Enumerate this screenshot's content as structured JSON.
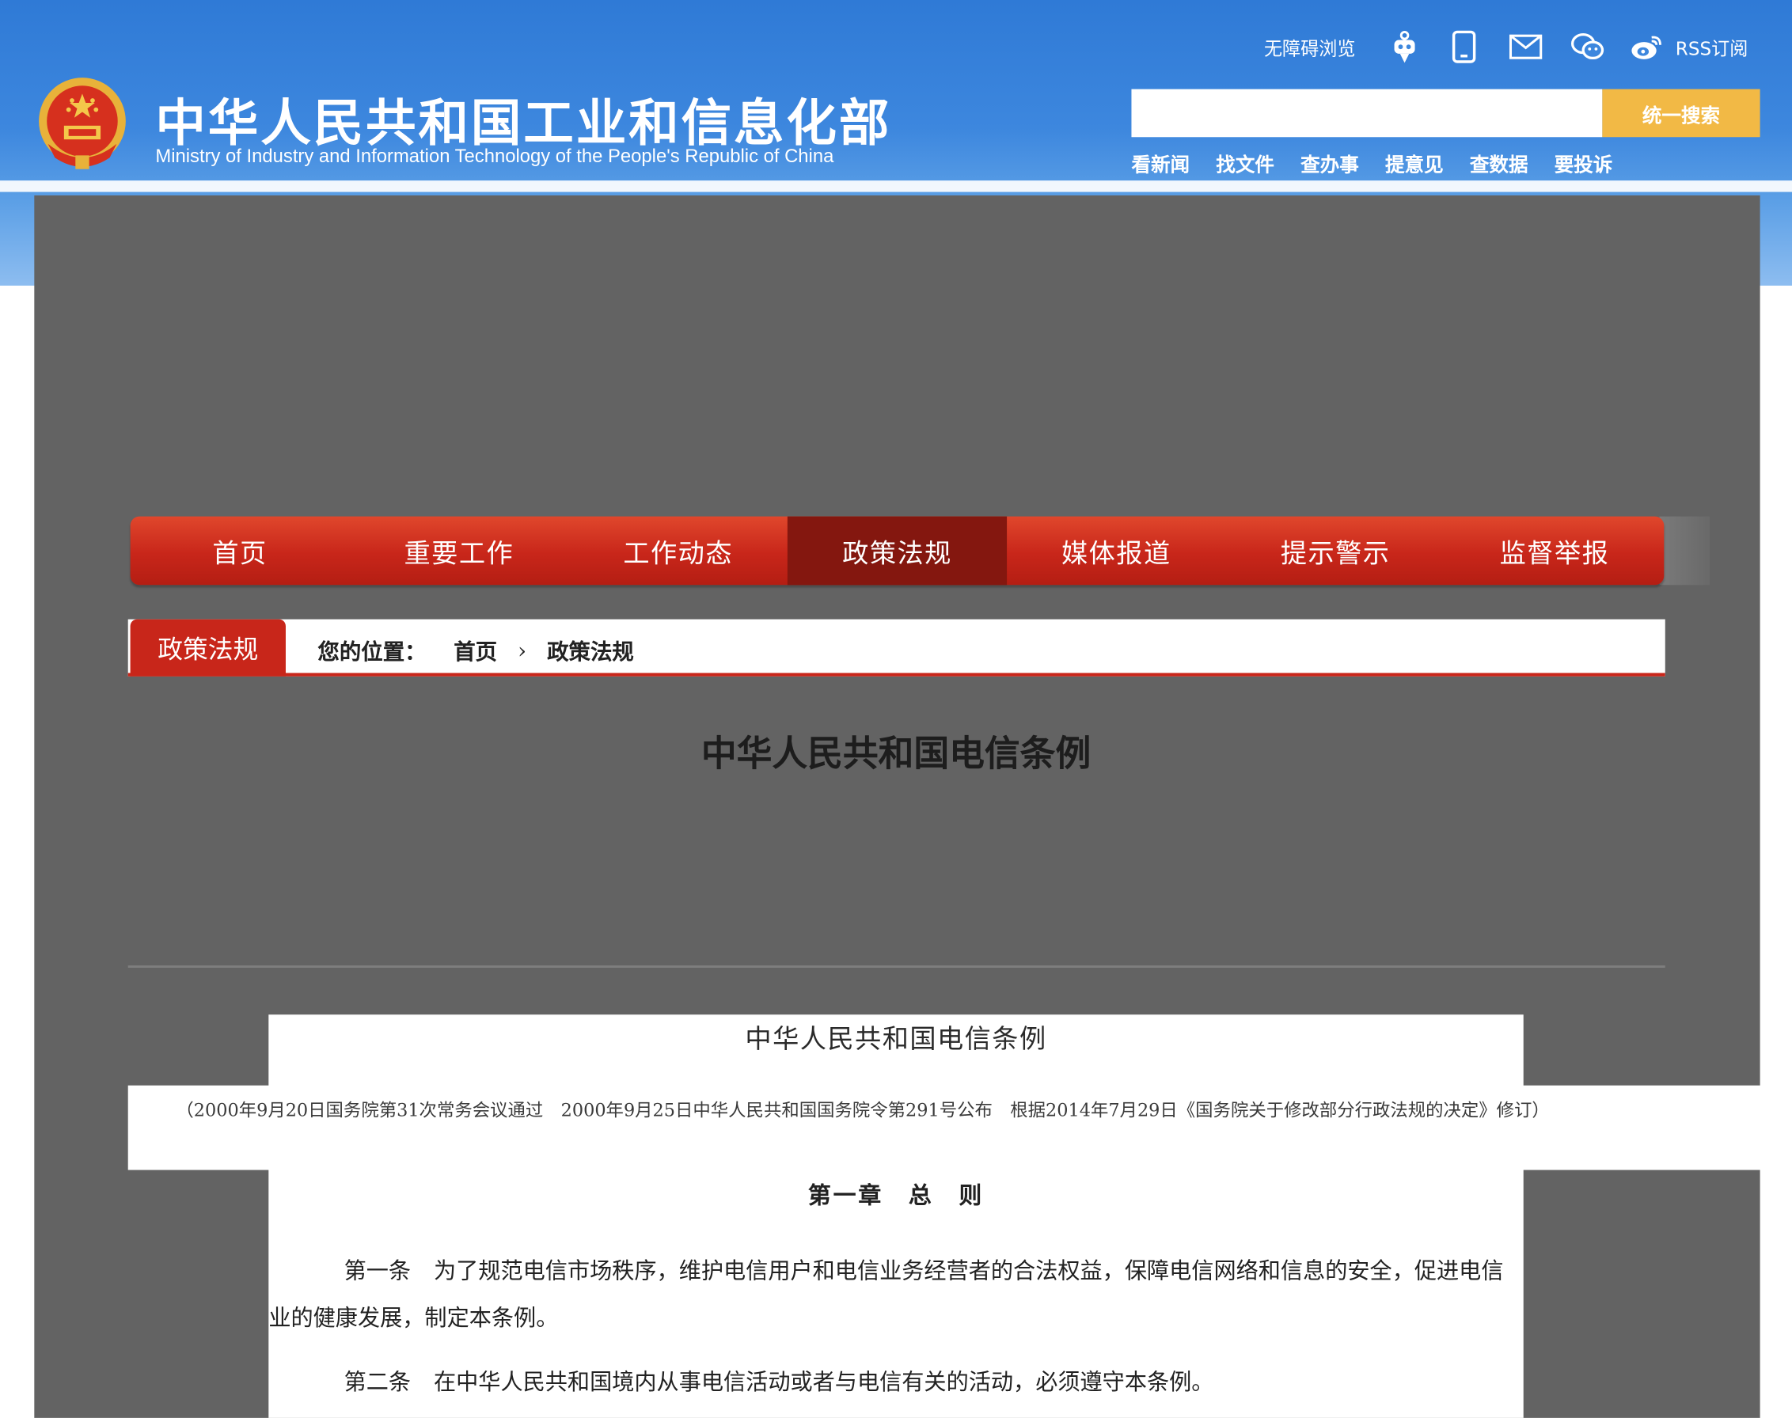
{
  "header": {
    "title": "中华人民共和国工业和信息化部",
    "subtitle": "Ministry of Industry and Information Technology of the People's Republic of China",
    "accessibility_label": "无障碍浏览",
    "rss_label": "RSS订阅",
    "icons": [
      "robot-icon",
      "mobile-icon",
      "mail-icon",
      "wechat-icon",
      "weibo-icon"
    ],
    "search_placeholder": "",
    "search_button": "统一搜索",
    "quick_links": [
      "看新闻",
      "找文件",
      "查办事",
      "提意见",
      "查数据",
      "要投诉"
    ]
  },
  "nav": {
    "items": [
      "首页",
      "重要工作",
      "工作动态",
      "政策法规",
      "媒体报道",
      "提示警示",
      "监督举报"
    ],
    "active": "政策法规"
  },
  "breadcrumb": {
    "section_tab": "政策法规",
    "label": "您的位置：",
    "home": "首页",
    "separator": "›",
    "current": "政策法规"
  },
  "article": {
    "title": "中华人民共和国电信条例",
    "doc_title": "中华人民共和国电信条例",
    "history": "（2000年9月20日国务院第31次常务会议通过　2000年9月25日中华人民共和国国务院令第291号公布　根据2014年7月29日《国务院关于修改部分行政法规的决定》修订）",
    "chapter": "第一章　总　则",
    "p1_label": "第一条",
    "p1_text": "为了规范电信市场秩序，维护电信用户和电信业务经营者的合法权益，保障电信网络和信息的安全，促进电信业的健康发展，制定本条例。",
    "p2_label": "第二条",
    "p2_text": "在中华人民共和国境内从事电信活动或者与电信有关的活动，必须遵守本条例。"
  },
  "colors": {
    "header_blue": "#2f7ad6",
    "nav_red": "#c8261a",
    "nav_active": "#84170f",
    "search_button": "#f2b945",
    "overlay_gray": "#636363"
  }
}
